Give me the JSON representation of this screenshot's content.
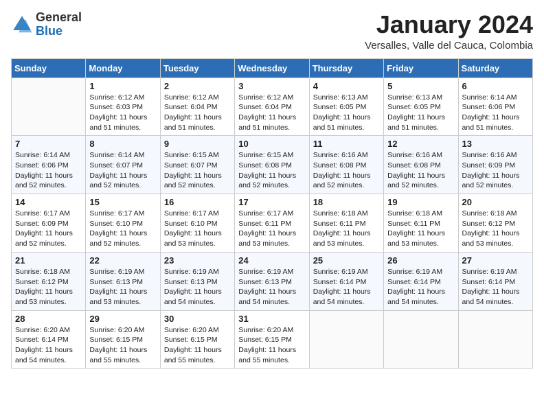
{
  "header": {
    "logo_general": "General",
    "logo_blue": "Blue",
    "title": "January 2024",
    "subtitle": "Versalles, Valle del Cauca, Colombia"
  },
  "weekdays": [
    "Sunday",
    "Monday",
    "Tuesday",
    "Wednesday",
    "Thursday",
    "Friday",
    "Saturday"
  ],
  "weeks": [
    [
      {
        "day": "",
        "sunrise": "",
        "sunset": "",
        "daylight": "",
        "empty": true
      },
      {
        "day": "1",
        "sunrise": "Sunrise: 6:12 AM",
        "sunset": "Sunset: 6:03 PM",
        "daylight": "Daylight: 11 hours and 51 minutes."
      },
      {
        "day": "2",
        "sunrise": "Sunrise: 6:12 AM",
        "sunset": "Sunset: 6:04 PM",
        "daylight": "Daylight: 11 hours and 51 minutes."
      },
      {
        "day": "3",
        "sunrise": "Sunrise: 6:12 AM",
        "sunset": "Sunset: 6:04 PM",
        "daylight": "Daylight: 11 hours and 51 minutes."
      },
      {
        "day": "4",
        "sunrise": "Sunrise: 6:13 AM",
        "sunset": "Sunset: 6:05 PM",
        "daylight": "Daylight: 11 hours and 51 minutes."
      },
      {
        "day": "5",
        "sunrise": "Sunrise: 6:13 AM",
        "sunset": "Sunset: 6:05 PM",
        "daylight": "Daylight: 11 hours and 51 minutes."
      },
      {
        "day": "6",
        "sunrise": "Sunrise: 6:14 AM",
        "sunset": "Sunset: 6:06 PM",
        "daylight": "Daylight: 11 hours and 51 minutes."
      }
    ],
    [
      {
        "day": "7",
        "sunrise": "Sunrise: 6:14 AM",
        "sunset": "Sunset: 6:06 PM",
        "daylight": "Daylight: 11 hours and 52 minutes."
      },
      {
        "day": "8",
        "sunrise": "Sunrise: 6:14 AM",
        "sunset": "Sunset: 6:07 PM",
        "daylight": "Daylight: 11 hours and 52 minutes."
      },
      {
        "day": "9",
        "sunrise": "Sunrise: 6:15 AM",
        "sunset": "Sunset: 6:07 PM",
        "daylight": "Daylight: 11 hours and 52 minutes."
      },
      {
        "day": "10",
        "sunrise": "Sunrise: 6:15 AM",
        "sunset": "Sunset: 6:08 PM",
        "daylight": "Daylight: 11 hours and 52 minutes."
      },
      {
        "day": "11",
        "sunrise": "Sunrise: 6:16 AM",
        "sunset": "Sunset: 6:08 PM",
        "daylight": "Daylight: 11 hours and 52 minutes."
      },
      {
        "day": "12",
        "sunrise": "Sunrise: 6:16 AM",
        "sunset": "Sunset: 6:08 PM",
        "daylight": "Daylight: 11 hours and 52 minutes."
      },
      {
        "day": "13",
        "sunrise": "Sunrise: 6:16 AM",
        "sunset": "Sunset: 6:09 PM",
        "daylight": "Daylight: 11 hours and 52 minutes."
      }
    ],
    [
      {
        "day": "14",
        "sunrise": "Sunrise: 6:17 AM",
        "sunset": "Sunset: 6:09 PM",
        "daylight": "Daylight: 11 hours and 52 minutes."
      },
      {
        "day": "15",
        "sunrise": "Sunrise: 6:17 AM",
        "sunset": "Sunset: 6:10 PM",
        "daylight": "Daylight: 11 hours and 52 minutes."
      },
      {
        "day": "16",
        "sunrise": "Sunrise: 6:17 AM",
        "sunset": "Sunset: 6:10 PM",
        "daylight": "Daylight: 11 hours and 53 minutes."
      },
      {
        "day": "17",
        "sunrise": "Sunrise: 6:17 AM",
        "sunset": "Sunset: 6:11 PM",
        "daylight": "Daylight: 11 hours and 53 minutes."
      },
      {
        "day": "18",
        "sunrise": "Sunrise: 6:18 AM",
        "sunset": "Sunset: 6:11 PM",
        "daylight": "Daylight: 11 hours and 53 minutes."
      },
      {
        "day": "19",
        "sunrise": "Sunrise: 6:18 AM",
        "sunset": "Sunset: 6:11 PM",
        "daylight": "Daylight: 11 hours and 53 minutes."
      },
      {
        "day": "20",
        "sunrise": "Sunrise: 6:18 AM",
        "sunset": "Sunset: 6:12 PM",
        "daylight": "Daylight: 11 hours and 53 minutes."
      }
    ],
    [
      {
        "day": "21",
        "sunrise": "Sunrise: 6:18 AM",
        "sunset": "Sunset: 6:12 PM",
        "daylight": "Daylight: 11 hours and 53 minutes."
      },
      {
        "day": "22",
        "sunrise": "Sunrise: 6:19 AM",
        "sunset": "Sunset: 6:13 PM",
        "daylight": "Daylight: 11 hours and 53 minutes."
      },
      {
        "day": "23",
        "sunrise": "Sunrise: 6:19 AM",
        "sunset": "Sunset: 6:13 PM",
        "daylight": "Daylight: 11 hours and 54 minutes."
      },
      {
        "day": "24",
        "sunrise": "Sunrise: 6:19 AM",
        "sunset": "Sunset: 6:13 PM",
        "daylight": "Daylight: 11 hours and 54 minutes."
      },
      {
        "day": "25",
        "sunrise": "Sunrise: 6:19 AM",
        "sunset": "Sunset: 6:14 PM",
        "daylight": "Daylight: 11 hours and 54 minutes."
      },
      {
        "day": "26",
        "sunrise": "Sunrise: 6:19 AM",
        "sunset": "Sunset: 6:14 PM",
        "daylight": "Daylight: 11 hours and 54 minutes."
      },
      {
        "day": "27",
        "sunrise": "Sunrise: 6:19 AM",
        "sunset": "Sunset: 6:14 PM",
        "daylight": "Daylight: 11 hours and 54 minutes."
      }
    ],
    [
      {
        "day": "28",
        "sunrise": "Sunrise: 6:20 AM",
        "sunset": "Sunset: 6:14 PM",
        "daylight": "Daylight: 11 hours and 54 minutes."
      },
      {
        "day": "29",
        "sunrise": "Sunrise: 6:20 AM",
        "sunset": "Sunset: 6:15 PM",
        "daylight": "Daylight: 11 hours and 55 minutes."
      },
      {
        "day": "30",
        "sunrise": "Sunrise: 6:20 AM",
        "sunset": "Sunset: 6:15 PM",
        "daylight": "Daylight: 11 hours and 55 minutes."
      },
      {
        "day": "31",
        "sunrise": "Sunrise: 6:20 AM",
        "sunset": "Sunset: 6:15 PM",
        "daylight": "Daylight: 11 hours and 55 minutes."
      },
      {
        "day": "",
        "sunrise": "",
        "sunset": "",
        "daylight": "",
        "empty": true
      },
      {
        "day": "",
        "sunrise": "",
        "sunset": "",
        "daylight": "",
        "empty": true
      },
      {
        "day": "",
        "sunrise": "",
        "sunset": "",
        "daylight": "",
        "empty": true
      }
    ]
  ]
}
